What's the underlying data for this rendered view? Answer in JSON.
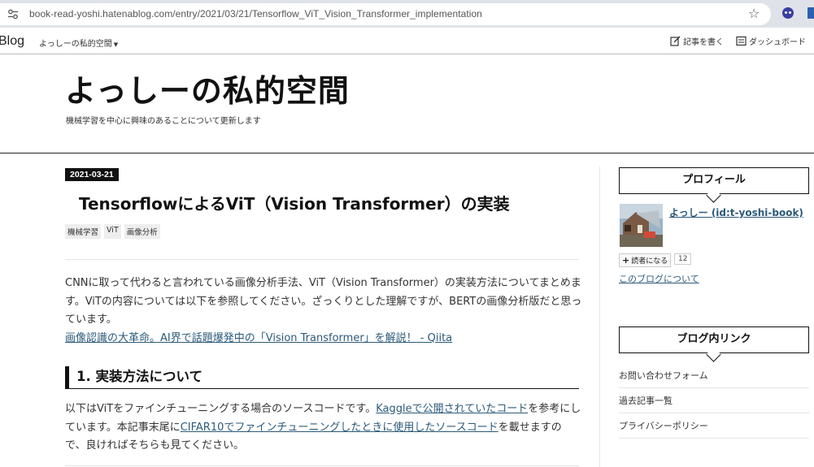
{
  "browser": {
    "url": "book-read-yoshi.hatenablog.com/entry/2021/03/21/Tensorflow_ViT_Vision_Transformer_implementation"
  },
  "hatena_bar": {
    "logo": "Blog",
    "blog_name": "よっしーの私的空間",
    "write": "記事を書く",
    "dashboard": "ダッシュボード"
  },
  "header": {
    "title": "よっしーの私的空間",
    "description": "機械学習を中心に興味のあることについて更新します"
  },
  "entry": {
    "date": "2021-03-21",
    "title": "TensorflowによるViT（Vision Transformer）の実装",
    "categories": [
      "機械学習",
      "ViT",
      "画像分析"
    ],
    "para1": "CNNに取って代わると言われている画像分析手法、ViT（Vision Transformer）の実装方法についてまとめます。ViTの内容については以下を参照してください。ざっくりとした理解ですが、BERTの画像分析版だと思っています。",
    "qiita_link": "画像認識の大革命。AI界で話題爆発中の「Vision Transformer」を解説！ - Qiita",
    "section1": "1. 実装方法について",
    "para2_a": "以下はViTをファインチューニングする場合のソースコードです。",
    "para2_link1": "Kaggleで公開されていたコード",
    "para2_b": "を参考にしています。本記事末尾に",
    "para2_link2": "CIFAR10でファインチューニングしたときに使用したソースコード",
    "para2_c": "を載せますので、良ければそちらも見てください。"
  },
  "sidebar": {
    "profile_title": "プロフィール",
    "profile_name": "よっしー (id:t-yoshi-book)",
    "reader_button": "読者になる",
    "reader_count": "12",
    "about": "このブログについて",
    "links_title": "ブログ内リンク",
    "links": [
      "お問い合わせフォーム",
      "過去記事一覧",
      "プライバシーポリシー"
    ]
  },
  "colors": {
    "link": "#2c5a7a",
    "browser_bar": "#dfe3e9"
  }
}
